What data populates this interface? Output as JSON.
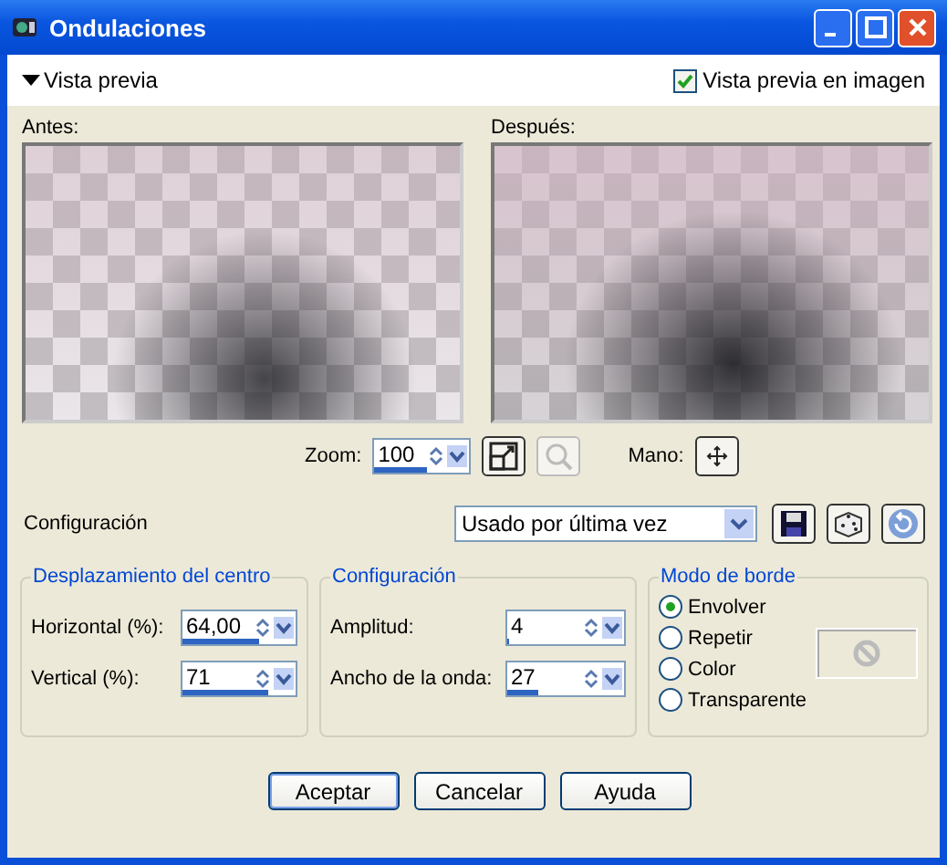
{
  "window": {
    "title": "Ondulaciones"
  },
  "preview_toggle": {
    "label": "Vista previa",
    "expanded": true
  },
  "preview_on_image": {
    "label": "Vista previa en imagen",
    "checked": true
  },
  "before": {
    "label": "Antes:"
  },
  "after": {
    "label": "Después:"
  },
  "zoom": {
    "label": "Zoom:",
    "value": "100",
    "level": 0.55
  },
  "hand": {
    "label": "Mano:"
  },
  "config": {
    "label": "Configuración",
    "value": "Usado por última vez"
  },
  "center_group": {
    "title": "Desplazamiento del centro",
    "fields": [
      {
        "label": "Horizontal (%):",
        "value": "64,00",
        "level": 0.68
      },
      {
        "label": "Vertical (%):",
        "value": "71",
        "level": 0.76
      }
    ]
  },
  "wave_group": {
    "title": "Configuración",
    "fields": [
      {
        "label": "Amplitud:",
        "value": "4",
        "level": 0.02
      },
      {
        "label": "Ancho de la onda:",
        "value": "27",
        "level": 0.27
      }
    ]
  },
  "border_group": {
    "title": "Modo de borde",
    "options": [
      {
        "label": "Envolver",
        "selected": true
      },
      {
        "label": "Repetir",
        "selected": false
      },
      {
        "label": "Color",
        "selected": false
      },
      {
        "label": "Transparente",
        "selected": false
      }
    ]
  },
  "buttons": [
    "Aceptar",
    "Cancelar",
    "Ayuda"
  ]
}
